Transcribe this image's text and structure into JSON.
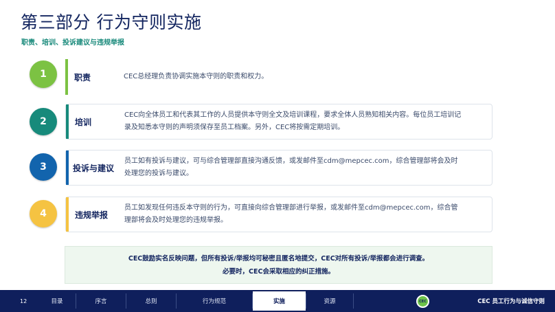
{
  "header": {
    "title": "第三部分 行为守则实施",
    "subtitle": "职责、培训、投诉建议与违规举报"
  },
  "rows": [
    {
      "number": "1",
      "label": "职责",
      "text": "CEC总经理负责协调实施本守则的职责和权力。",
      "color": "#7cc243"
    },
    {
      "number": "2",
      "label": "培训",
      "text": "CEC向全体员工和代表其工作的人员提供本守则全文及培训课程，要求全体人员熟知相关内容。每位员工培训记录及知悉本守则的声明须保存至员工档案。另外，CEC将按需定期培训。",
      "color": "#178a7b"
    },
    {
      "number": "3",
      "label": "投诉与建议",
      "text": "员工如有投诉与建议，可与综合管理部直接沟通反馈，或发邮件至cdm@mepcec.com，综合管理部将会及时处理您的投诉与建议。",
      "color": "#1264ad"
    },
    {
      "number": "4",
      "label": "违规举报",
      "text": "员工如发现任何违反本守则的行为，可直接向综合管理部进行举报，或发邮件至cdm@mepcec.com，综合管理部将会及时处理您的违规举报。",
      "color": "#f5c342"
    }
  ],
  "note": {
    "line1": "CEC鼓励实名反映问题，但所有投诉/举报均可秘密且匿名地提交，CEC对所有投诉/举报都会进行调查。",
    "line2": "必要时，CEC会采取相应的纠正措施。"
  },
  "footer": {
    "page_number": "12",
    "nav": [
      "目录",
      "序言",
      "总则",
      "行为规范",
      "实施",
      "资源"
    ],
    "active_nav": "实施",
    "logo_text": "CEC",
    "brand": "CEC 员工行为与诚信守则"
  }
}
